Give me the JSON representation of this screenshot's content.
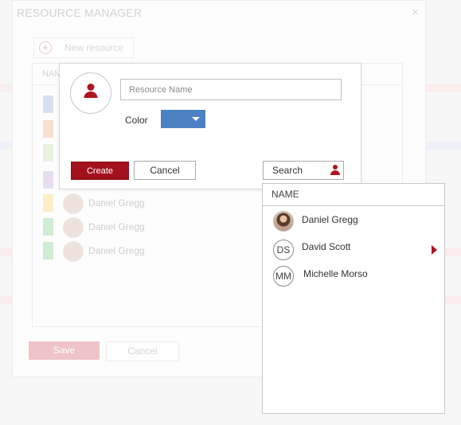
{
  "colors": {
    "accent": "#a3101e",
    "swatch_blue": "#4c82c3"
  },
  "background_dialog": {
    "title": "RESOURCE MANAGER",
    "close_glyph": "×",
    "new_resource_label": "New resource",
    "list_header": "NAME",
    "rows": [
      {
        "name": "Daniel Gregg"
      },
      {
        "name": "Daniel Gregg"
      },
      {
        "name": "Daniel Gregg"
      }
    ],
    "save_label": "Save",
    "cancel_label": "Cancel"
  },
  "create_popup": {
    "name_placeholder": "Resource Name",
    "color_label": "Color",
    "color_value": "#4c82c3",
    "create_label": "Create",
    "cancel_label": "Cancel",
    "search_label": "Search"
  },
  "search_dropdown": {
    "header": "NAME",
    "items": [
      {
        "name": "Daniel Gregg",
        "initials": "",
        "has_photo": true
      },
      {
        "name": "David Scott",
        "initials": "DS",
        "has_photo": false
      },
      {
        "name": "Michelle Morso",
        "initials": "MM",
        "has_photo": false
      }
    ]
  }
}
